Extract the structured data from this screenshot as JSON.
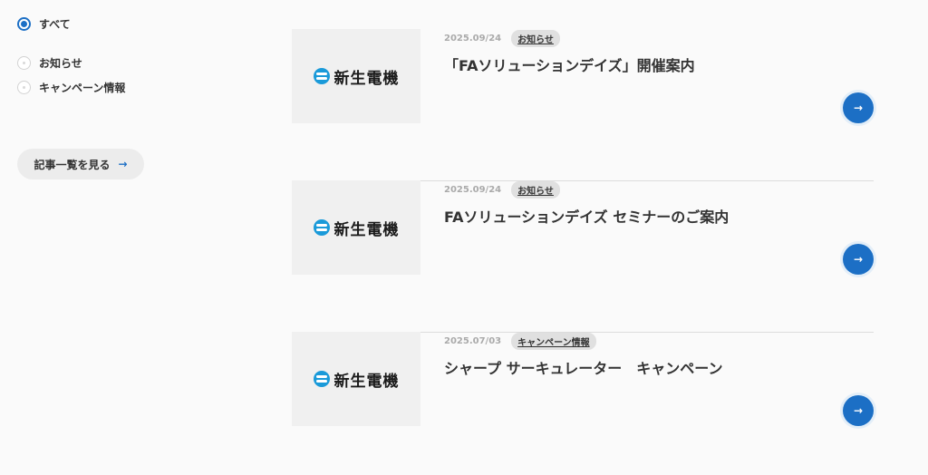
{
  "filter": {
    "options": [
      {
        "label": "すべて",
        "selected": true
      },
      {
        "label": "お知らせ",
        "selected": false
      },
      {
        "label": "キャンペーン情報",
        "selected": false
      }
    ]
  },
  "list_button": {
    "label": "記事一覧を見る",
    "arrow": "→"
  },
  "articles": [
    {
      "date": "2025.09/24",
      "tag": "お知らせ",
      "title": "「FAソリューションデイズ」開催案内",
      "logo": "新生電機",
      "arrow": "→"
    },
    {
      "date": "2025.09/24",
      "tag": "お知らせ",
      "title": "FAソリューションデイズ セミナーのご案内",
      "logo": "新生電機",
      "arrow": "→"
    },
    {
      "date": "2025.07/03",
      "tag": "キャンペーン情報",
      "title": "シャープ サーキュレーター　キャンペーン",
      "logo": "新生電機",
      "arrow": "→"
    }
  ],
  "colors": {
    "accent": "#1c6fc5",
    "logo_mark": "#1a9ad9"
  }
}
